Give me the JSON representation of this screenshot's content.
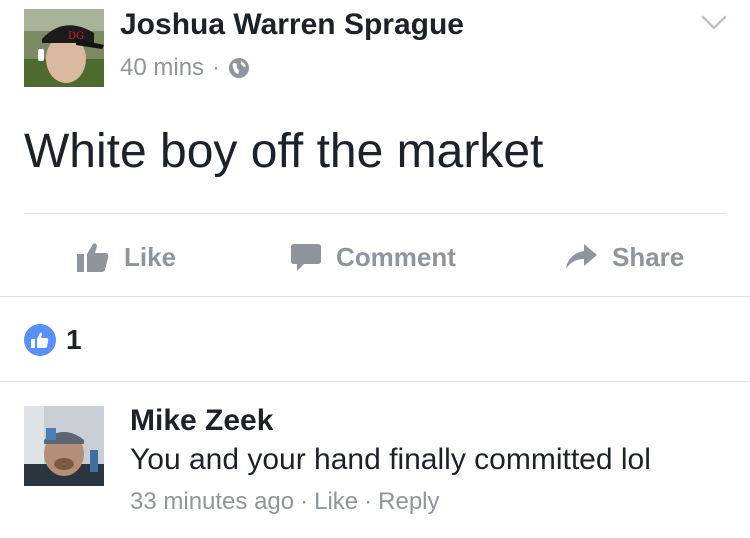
{
  "post": {
    "author": "Joshua Warren Sprague",
    "time": "40 mins",
    "separator": "·",
    "privacy_icon": "globe-icon",
    "text": "White boy off the market",
    "menu_icon": "chevron-down-icon"
  },
  "actions": {
    "like_label": "Like",
    "comment_label": "Comment",
    "share_label": "Share"
  },
  "reactions": {
    "icon": "like-reaction-icon",
    "count": "1"
  },
  "comment": {
    "author": "Mike Zeek",
    "text": "You and your hand finally committed lol",
    "time": "33 minutes ago",
    "sep1": "·",
    "like_label": "Like",
    "sep2": "·",
    "reply_label": "Reply"
  },
  "colors": {
    "text_primary": "#1d2129",
    "text_secondary": "#90949c",
    "divider": "#dddfe2",
    "reaction_blue": "#5890ff"
  }
}
